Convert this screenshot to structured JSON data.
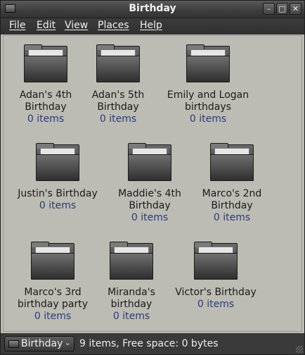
{
  "window": {
    "title": "Birthday"
  },
  "menu": [
    "File",
    "Edit",
    "View",
    "Places",
    "Help"
  ],
  "items": [
    {
      "name": "Adan's 4th Birthday",
      "count": "0 items"
    },
    {
      "name": "Adan's 5th Birthday",
      "count": "0 items"
    },
    {
      "name": "Emily and Logan birthdays",
      "count": "0 items"
    },
    {
      "name": "Justin's Birthday",
      "count": "0 items"
    },
    {
      "name": "Maddie's 4th Birthday",
      "count": "0 items"
    },
    {
      "name": "Marco's 2nd Birthday",
      "count": "0 items"
    },
    {
      "name": "Marco's 3rd birthday party",
      "count": "0 items"
    },
    {
      "name": "Miranda's birthday",
      "count": "0 items"
    },
    {
      "name": "Victor's Birthday",
      "count": "0 items"
    }
  ],
  "status": {
    "location": "Birthday",
    "text": "9 items, Free space: 0 bytes"
  }
}
